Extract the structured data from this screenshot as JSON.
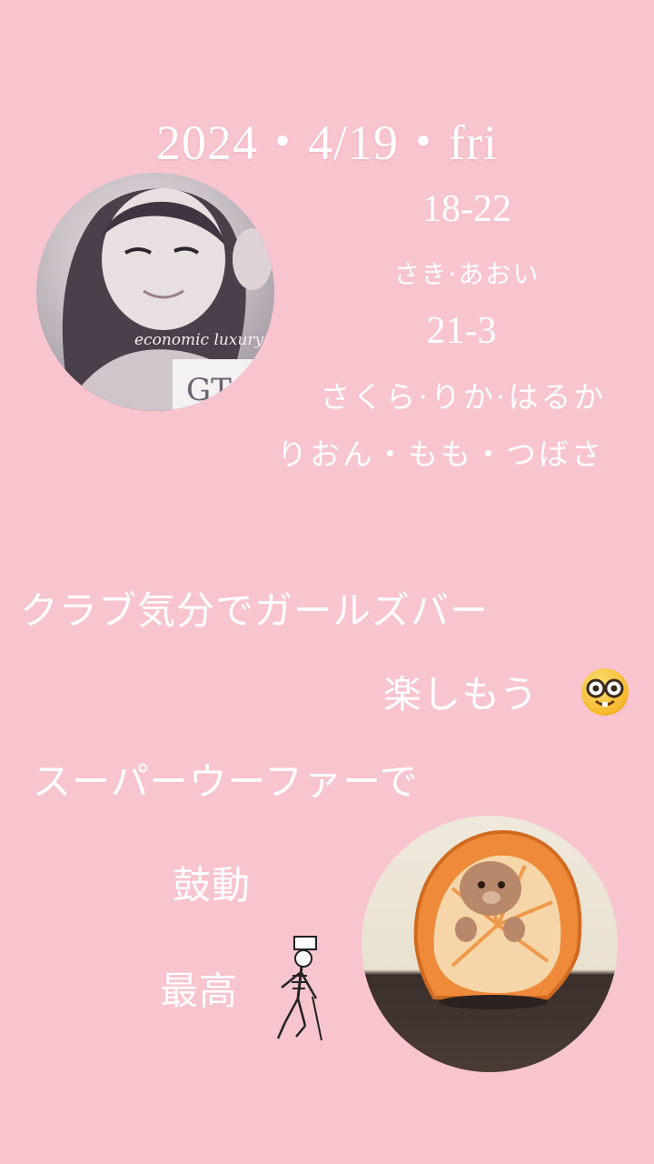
{
  "event": {
    "date": "2024・4/19・fri"
  },
  "shift1": {
    "time": "18-22",
    "names": "さき·あおい"
  },
  "shift2": {
    "time": "21-3",
    "names_line1": "さくら·りか·はるか",
    "names_line2": "りおん・もも・つばさ"
  },
  "message": {
    "line1": "クラブ気分でガールズバー",
    "line2": "楽しもう",
    "line3": "スーパーウーファーで",
    "line4": "鼓動",
    "line5": "最高"
  },
  "avatar": {
    "watermark": "economic luxury"
  },
  "icons": {
    "nerd": "nerd-face-emoji",
    "skeleton": "dancing-skeleton-sticker"
  },
  "colors": {
    "background": "#f8c4ce",
    "text": "#ffffff"
  }
}
